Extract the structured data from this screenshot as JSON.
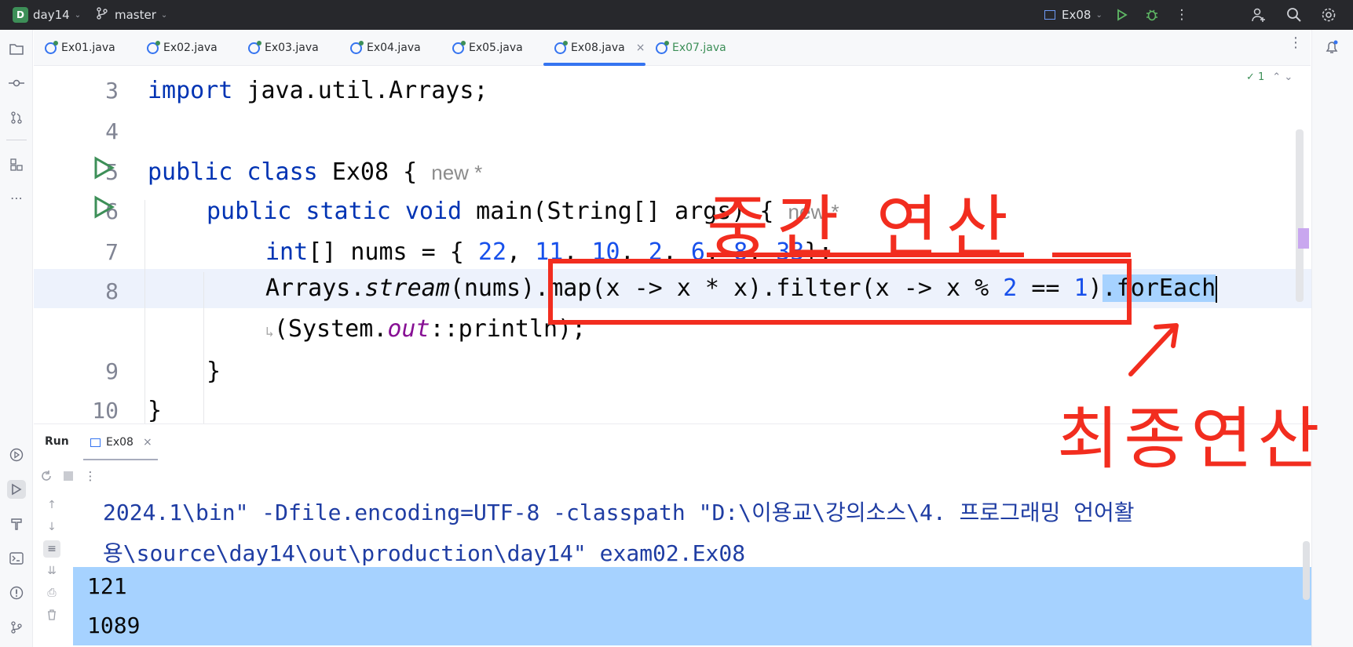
{
  "titlebar": {
    "project_badge": "D",
    "project": "day14",
    "branch": "master",
    "run_config": "Ex08",
    "icons": [
      "branch-icon",
      "run-config-icon",
      "run-icon",
      "debug-icon",
      "more-icon",
      "add-user-icon",
      "search-icon",
      "settings-icon"
    ]
  },
  "tabs": [
    {
      "label": "Ex01.java"
    },
    {
      "label": "Ex02.java"
    },
    {
      "label": "Ex03.java"
    },
    {
      "label": "Ex04.java"
    },
    {
      "label": "Ex05.java"
    },
    {
      "label": "Ex08.java",
      "active": true,
      "close": "×"
    },
    {
      "label": "Ex07.java"
    }
  ],
  "editor": {
    "inspection": "✓ 1",
    "line_numbers": [
      "3",
      "4",
      "5",
      "6",
      "7",
      "8",
      "9",
      "10"
    ],
    "hint_new": "new *",
    "lines": {
      "l3_kw": "import",
      "l3_rest": " java.util.Arrays;",
      "l5_kw": "public class",
      "l5_rest": " Ex08 { ",
      "l6_kw": "public static void",
      "l6_rest": " main(String[] args) { ",
      "l7_kw": "int",
      "l7_a": "[] nums = { ",
      "l7_nums": [
        "22",
        "11",
        "10",
        "2",
        "6",
        "8",
        "33"
      ],
      "l7_end": "};",
      "l8_a": "Arrays.",
      "l8_stream": "stream",
      "l8_b": "(nums).map(x -> x * x).filter(x -> x % ",
      "l8_n1": "2",
      "l8_c": " == ",
      "l8_n2": "1",
      "l8_d": ")",
      "l8_sel": ".forEach",
      "l8w_a": "(System.",
      "l8w_out": "out",
      "l8w_b": "::println);",
      "l9": "}",
      "l10": "}"
    }
  },
  "run": {
    "title": "Run",
    "tab": "Ex08",
    "tab_close": "×",
    "console": {
      "cmd1": "2024.1\\bin\" -Dfile.encoding=UTF-8 -classpath \"D:\\이용교\\강의소스\\4. 프로그래밍 언어활",
      "cmd2": "용\\source\\day14\\out\\production\\day14\" exam02.Ex08",
      "out1": "121",
      "out2": "1089"
    }
  },
  "annotations": {
    "intermediate": "중간 연산",
    "terminal": "최종연산",
    "color": "#f22d1f"
  }
}
